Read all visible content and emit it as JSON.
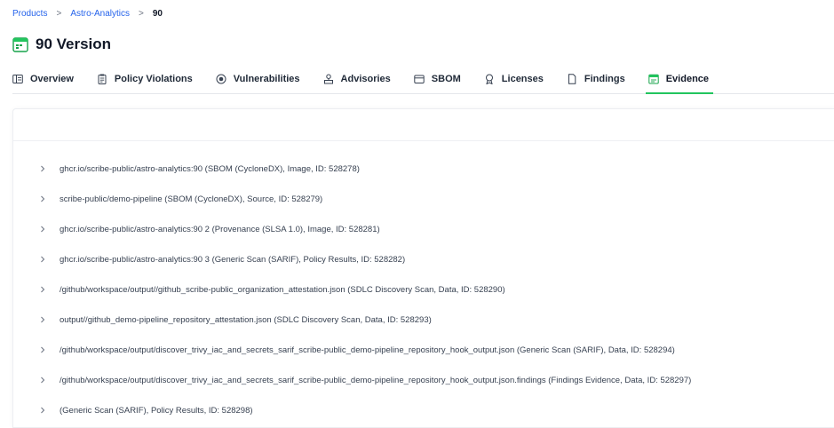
{
  "breadcrumb": {
    "items": [
      "Products",
      "Astro-Analytics",
      "90"
    ],
    "separator": ">"
  },
  "page": {
    "title": "90 Version",
    "icon": "calendar-icon"
  },
  "tabs": [
    {
      "label": "Overview",
      "icon": "overview-icon"
    },
    {
      "label": "Policy Violations",
      "icon": "clipboard-icon"
    },
    {
      "label": "Vulnerabilities",
      "icon": "bug-icon"
    },
    {
      "label": "Advisories",
      "icon": "advisory-icon"
    },
    {
      "label": "SBOM",
      "icon": "box-icon"
    },
    {
      "label": "Licenses",
      "icon": "license-icon"
    },
    {
      "label": "Findings",
      "icon": "document-icon"
    },
    {
      "label": "Evidence",
      "icon": "evidence-icon"
    }
  ],
  "active_tab": "Evidence",
  "evidence": [
    "ghcr.io/scribe-public/astro-analytics:90 (SBOM (CycloneDX), Image, ID: 528278)",
    "scribe-public/demo-pipeline (SBOM (CycloneDX), Source, ID: 528279)",
    "ghcr.io/scribe-public/astro-analytics:90 2 (Provenance (SLSA 1.0), Image, ID: 528281)",
    "ghcr.io/scribe-public/astro-analytics:90 3 (Generic Scan (SARIF), Policy Results, ID: 528282)",
    "/github/workspace/output//github_scribe-public_organization_attestation.json (SDLC Discovery Scan, Data, ID: 528290)",
    "output//github_demo-pipeline_repository_attestation.json (SDLC Discovery Scan, Data, ID: 528293)",
    "/github/workspace/output/discover_trivy_iac_and_secrets_sarif_scribe-public_demo-pipeline_repository_hook_output.json (Generic Scan (SARIF), Data, ID: 528294)",
    "/github/workspace/output/discover_trivy_iac_and_secrets_sarif_scribe-public_demo-pipeline_repository_hook_output.json.findings (Findings Evidence, Data, ID: 528297)",
    "(Generic Scan (SARIF), Policy Results, ID: 528298)"
  ],
  "colors": {
    "accent": "#22c55e",
    "link": "#2563eb"
  }
}
